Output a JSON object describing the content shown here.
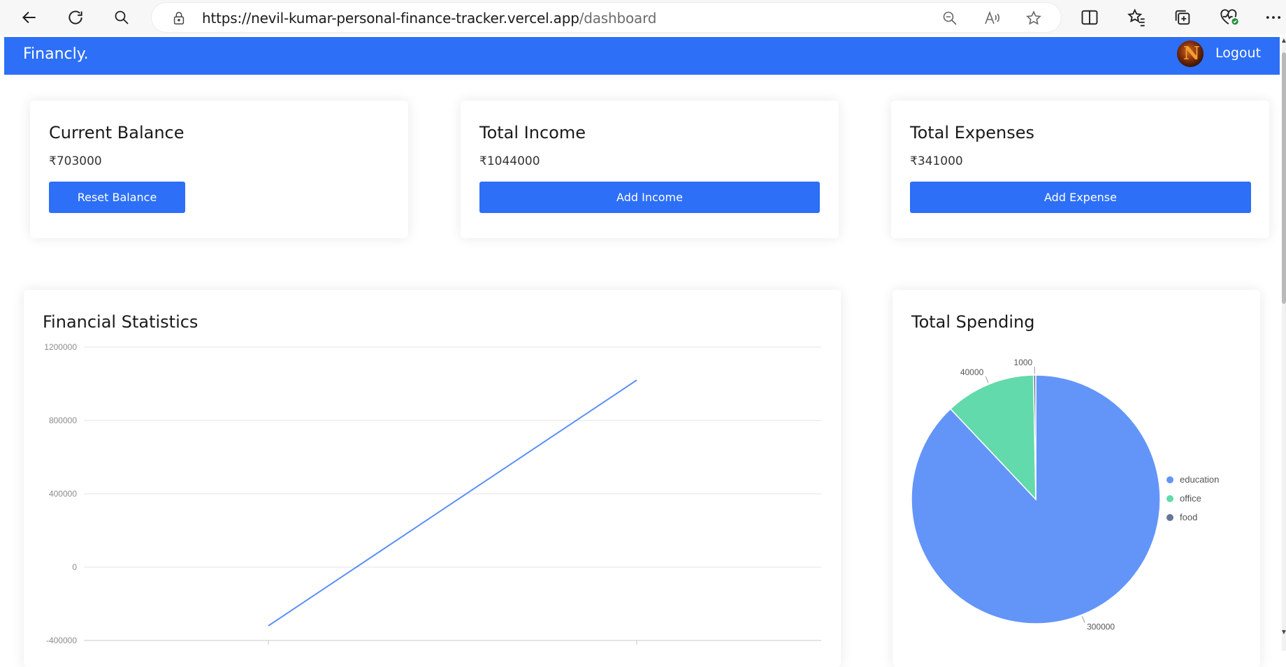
{
  "browser": {
    "url_host": "https://nevil-kumar-personal-finance-tracker.vercel.app",
    "url_path": "/dashboard"
  },
  "header": {
    "brand": "Financly.",
    "avatar_letter": "N",
    "logout_label": "Logout",
    "color": "#2d6ff7"
  },
  "cards": {
    "balance": {
      "title": "Current Balance",
      "amount": "₹703000",
      "button": "Reset Balance"
    },
    "income": {
      "title": "Total Income",
      "amount": "₹1044000",
      "button": "Add Income"
    },
    "expenses": {
      "title": "Total Expenses",
      "amount": "₹341000",
      "button": "Add Expense"
    }
  },
  "stats_title": "Financial Statistics",
  "spending_title": "Total Spending",
  "chart_data": [
    {
      "type": "line",
      "title": "Financial Statistics",
      "yticks": [
        "1200000",
        "800000",
        "400000",
        "0",
        "-400000"
      ],
      "ylim": [
        -400000,
        1200000
      ],
      "x": [
        0,
        1
      ],
      "series": [
        {
          "values": [
            -320000,
            1020000
          ],
          "color": "#5b8ff9"
        }
      ],
      "grid": true
    },
    {
      "type": "pie",
      "title": "Total Spending",
      "categories": [
        "education",
        "office",
        "food"
      ],
      "values": [
        300000,
        40000,
        1000
      ],
      "colors": [
        "#6395f9",
        "#62daab",
        "#657798"
      ],
      "legend": "right"
    }
  ]
}
